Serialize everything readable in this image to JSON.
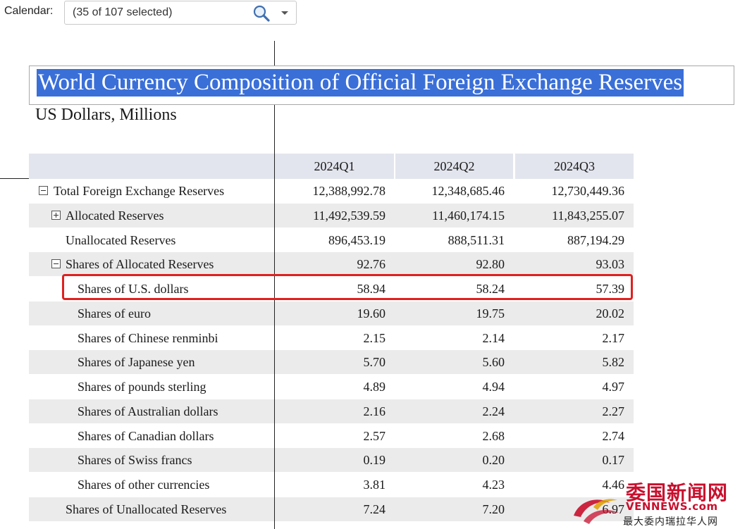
{
  "filter": {
    "label": "Calendar:",
    "value": "(35 of 107 selected)"
  },
  "report": {
    "title": "World Currency Composition of Official Foreign Exchange Reserves",
    "subtitle": "US Dollars, Millions"
  },
  "table": {
    "columns": [
      "2024Q1",
      "2024Q2",
      "2024Q3"
    ],
    "rows": [
      {
        "label": "Total Foreign Exchange Reserves",
        "level": 0,
        "toggle": "collapse",
        "values": [
          "12,388,992.78",
          "12,348,685.46",
          "12,730,449.36"
        ]
      },
      {
        "label": "Allocated Reserves",
        "level": 1,
        "toggle": "expand",
        "values": [
          "11,492,539.59",
          "11,460,174.15",
          "11,843,255.07"
        ]
      },
      {
        "label": "Unallocated Reserves",
        "level": 1,
        "toggle": "none",
        "values": [
          "896,453.19",
          "888,511.31",
          "887,194.29"
        ]
      },
      {
        "label": "Shares of Allocated Reserves",
        "level": 1,
        "toggle": "collapse",
        "values": [
          "92.76",
          "92.80",
          "93.03"
        ]
      },
      {
        "label": "Shares of U.S. dollars",
        "level": 2,
        "toggle": "none",
        "values": [
          "58.94",
          "58.24",
          "57.39"
        ],
        "highlighted": true
      },
      {
        "label": "Shares of euro",
        "level": 2,
        "toggle": "none",
        "values": [
          "19.60",
          "19.75",
          "20.02"
        ]
      },
      {
        "label": "Shares of Chinese renminbi",
        "level": 2,
        "toggle": "none",
        "values": [
          "2.15",
          "2.14",
          "2.17"
        ]
      },
      {
        "label": "Shares of Japanese yen",
        "level": 2,
        "toggle": "none",
        "values": [
          "5.70",
          "5.60",
          "5.82"
        ]
      },
      {
        "label": "Shares of pounds sterling",
        "level": 2,
        "toggle": "none",
        "values": [
          "4.89",
          "4.94",
          "4.97"
        ]
      },
      {
        "label": "Shares of Australian dollars",
        "level": 2,
        "toggle": "none",
        "values": [
          "2.16",
          "2.24",
          "2.27"
        ]
      },
      {
        "label": "Shares of Canadian dollars",
        "level": 2,
        "toggle": "none",
        "values": [
          "2.57",
          "2.68",
          "2.74"
        ]
      },
      {
        "label": "Shares of Swiss francs",
        "level": 2,
        "toggle": "none",
        "values": [
          "0.19",
          "0.20",
          "0.17"
        ]
      },
      {
        "label": "Shares of other currencies",
        "level": 2,
        "toggle": "none",
        "values": [
          "3.81",
          "4.23",
          "4.46"
        ]
      },
      {
        "label": "Shares of Unallocated Reserves",
        "level": 1,
        "toggle": "none",
        "values": [
          "7.24",
          "7.20",
          "6.97"
        ]
      }
    ]
  },
  "watermark": {
    "name": "委国新闻网",
    "url": "VENNEWS.com",
    "tagline": "最大委内瑞拉华人网"
  },
  "colors": {
    "title_highlight": "#3a6fd8",
    "header_bg": "#e3e5ee",
    "zebra_bg": "#ebebeb",
    "annotation_red": "#e02020",
    "watermark_red": "#c8102e"
  },
  "icons": {
    "search": "search-icon",
    "dropdown": "chevron-down-icon",
    "expand": "plus-box-icon",
    "collapse": "minus-box-icon"
  }
}
